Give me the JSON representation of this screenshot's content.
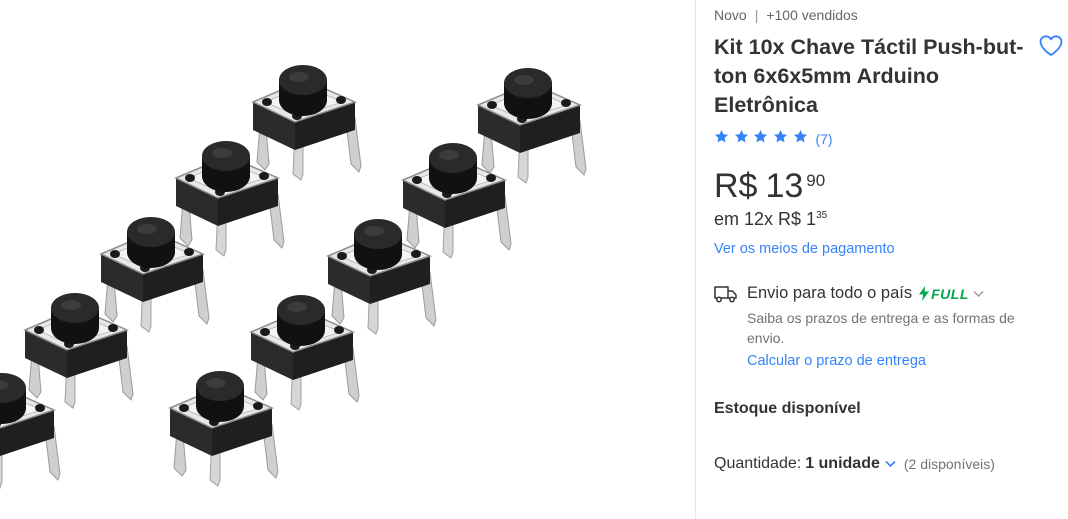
{
  "product": {
    "condition": "Novo",
    "separator": "|",
    "sold": "+100 vendidos",
    "title": "Kit 10x Chave Táctil Push-but-ton 6x6x5mm Arduino Eletrônica",
    "rating_value": 5,
    "rating_count": "(7)"
  },
  "price": {
    "currency": "R$",
    "integer": "13",
    "cents": "90"
  },
  "installments": {
    "text": "em 12x R$ 1",
    "cents": "35"
  },
  "payment_link": "Ver os meios de pagamento",
  "shipping": {
    "title": "Envio para todo o país",
    "badge": "FULL",
    "description": "Saiba os prazos de entrega e as formas de envio.",
    "link": "Calcular o prazo de entrega"
  },
  "stock": "Estoque disponível",
  "quantity": {
    "label": "Quantidade:",
    "value": "1 unidade",
    "available": "(2 disponíveis)"
  },
  "colors": {
    "accent": "#3483fa",
    "full_green": "#00a650",
    "star": "#3483fa"
  },
  "icons": [
    "heart-icon",
    "star-icon",
    "truck-icon",
    "lightning-icon",
    "chevron-down-icon"
  ]
}
